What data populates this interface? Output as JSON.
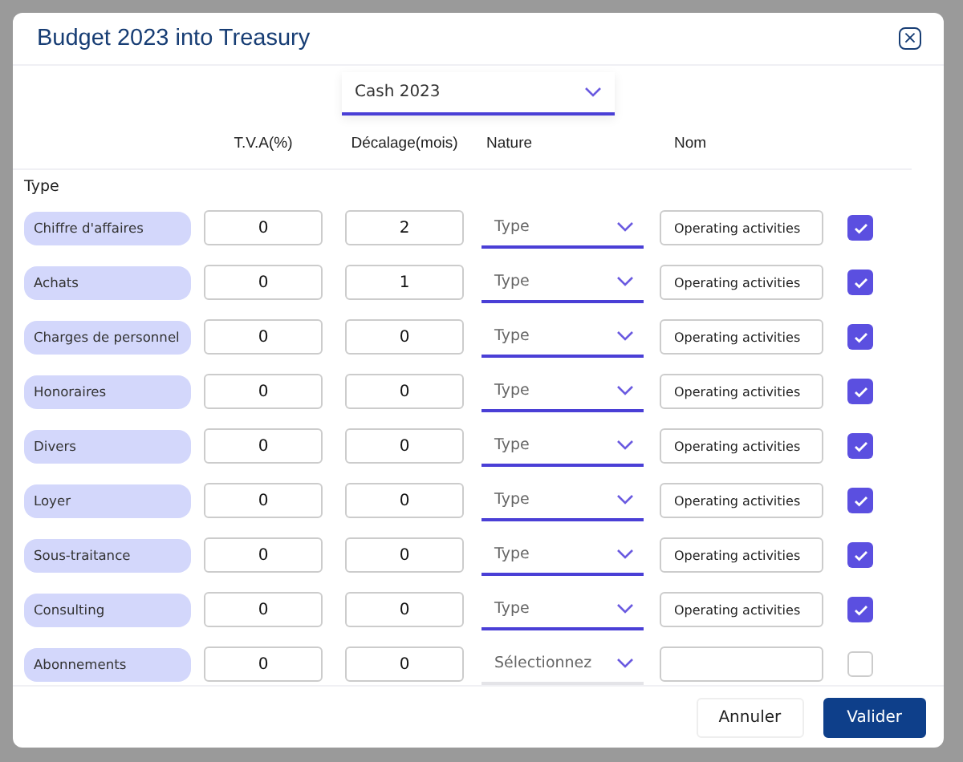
{
  "dialog": {
    "title": "Budget 2023 into Treasury",
    "close_label": "×"
  },
  "source": {
    "value": "Cash 2023"
  },
  "columns": [
    "T.V.A(%)",
    "Décalage(mois)",
    "Nature",
    "Nom"
  ],
  "section_label": "Type",
  "rows": [
    {
      "label": "Chiffre d'affaires",
      "tva": "0",
      "delay": "2",
      "nature": {
        "value": "Type",
        "highlighted": true
      },
      "name": "Operating activities",
      "checked": true
    },
    {
      "label": "Achats",
      "tva": "0",
      "delay": "1",
      "nature": {
        "value": "Type",
        "highlighted": true
      },
      "name": "Operating activities",
      "checked": true
    },
    {
      "label": "Charges de personnel",
      "tva": "0",
      "delay": "0",
      "nature": {
        "value": "Type",
        "highlighted": true
      },
      "name": "Operating activities",
      "checked": true
    },
    {
      "label": "Honoraires",
      "tva": "0",
      "delay": "0",
      "nature": {
        "value": "Type",
        "highlighted": true
      },
      "name": "Operating activities",
      "checked": true
    },
    {
      "label": "Divers",
      "tva": "0",
      "delay": "0",
      "nature": {
        "value": "Type",
        "highlighted": true
      },
      "name": "Operating activities",
      "checked": true
    },
    {
      "label": "Loyer",
      "tva": "0",
      "delay": "0",
      "nature": {
        "value": "Type",
        "highlighted": true
      },
      "name": "Operating activities",
      "checked": true
    },
    {
      "label": "Sous-traitance",
      "tva": "0",
      "delay": "0",
      "nature": {
        "value": "Type",
        "highlighted": true
      },
      "name": "Operating activities",
      "checked": true
    },
    {
      "label": "Consulting",
      "tva": "0",
      "delay": "0",
      "nature": {
        "value": "Type",
        "highlighted": true
      },
      "name": "Operating activities",
      "checked": true
    },
    {
      "label": "Abonnements",
      "tva": "0",
      "delay": "0",
      "nature": {
        "placeholder": "Sélectionnez",
        "highlighted": false
      },
      "checked": false
    }
  ],
  "buttons": [
    {
      "label": "Annuler",
      "kind": "secondary"
    },
    {
      "label": "Valider",
      "kind": "primary"
    }
  ]
}
